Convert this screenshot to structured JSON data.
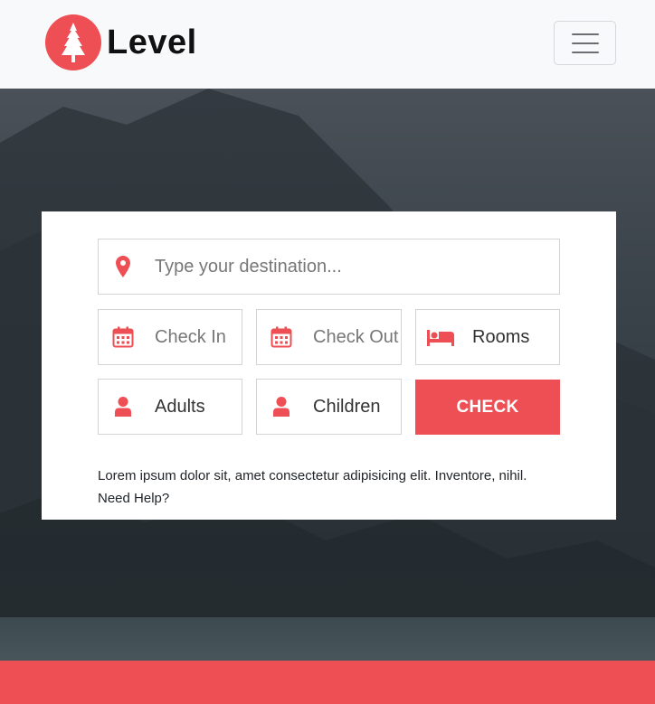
{
  "brand": {
    "name": "Level",
    "logo_icon": "pine-tree-icon"
  },
  "navbar": {
    "toggle_icon": "hamburger-menu-icon"
  },
  "booking": {
    "destination": {
      "placeholder": "Type your destination...",
      "icon": "map-pin-icon"
    },
    "check_in": {
      "placeholder": "Check In",
      "icon": "calendar-icon"
    },
    "check_out": {
      "placeholder": "Check Out",
      "icon": "calendar-icon"
    },
    "rooms": {
      "label": "Rooms",
      "icon": "bed-icon"
    },
    "adults": {
      "label": "Adults",
      "icon": "user-icon"
    },
    "children": {
      "label": "Children",
      "icon": "user-icon"
    },
    "submit_label": "CHECK",
    "note_text": "Lorem ipsum dolor sit, amet consectetur adipisicing elit. Inventore, nihil.",
    "help_text": "Need Help?"
  },
  "colors": {
    "accent": "#ee4f55",
    "navbar_bg": "#f8f9fa",
    "hero_overlay": "#3a4249",
    "field_border": "#d4d4d4"
  }
}
